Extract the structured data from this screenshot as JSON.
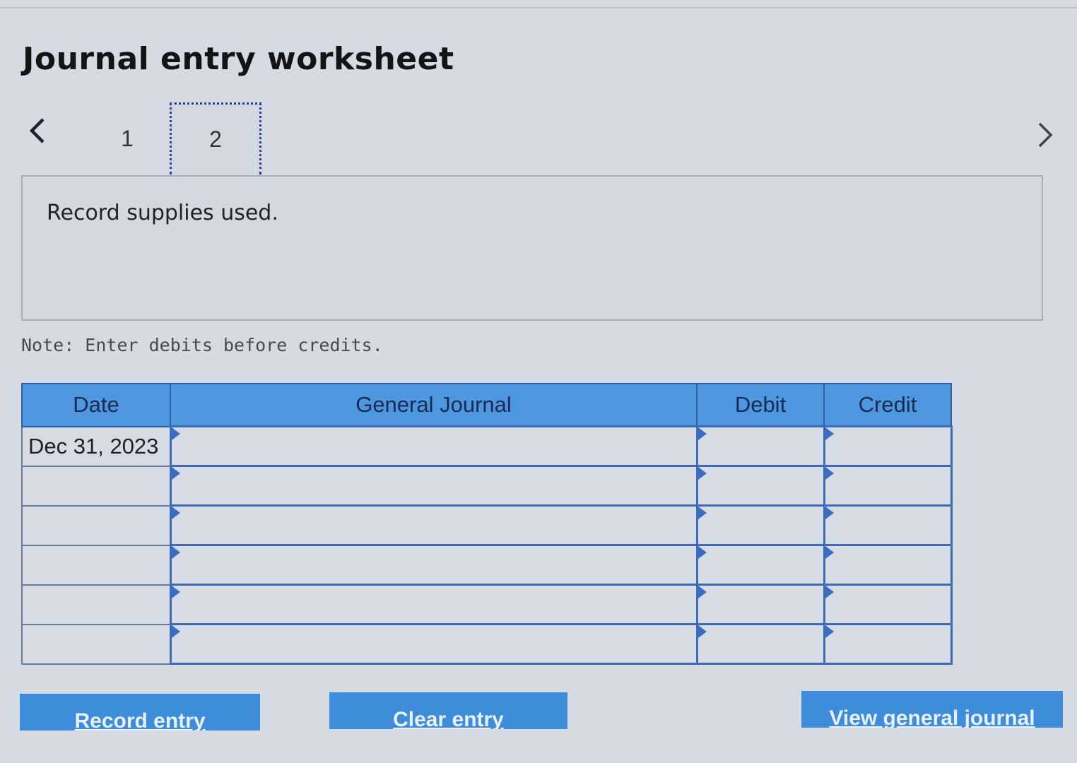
{
  "worksheet": {
    "title": "Journal entry worksheet",
    "steps": [
      "1",
      "2"
    ],
    "active_step": "2",
    "instruction": "Record supplies used.",
    "note": "Note: Enter debits before credits."
  },
  "table": {
    "headers": {
      "date": "Date",
      "general_journal": "General Journal",
      "debit": "Debit",
      "credit": "Credit"
    },
    "rows": [
      {
        "date": "Dec 31, 2023",
        "account": "",
        "debit": "",
        "credit": ""
      },
      {
        "date": "",
        "account": "",
        "debit": "",
        "credit": ""
      },
      {
        "date": "",
        "account": "",
        "debit": "",
        "credit": ""
      },
      {
        "date": "",
        "account": "",
        "debit": "",
        "credit": ""
      },
      {
        "date": "",
        "account": "",
        "debit": "",
        "credit": ""
      },
      {
        "date": "",
        "account": "",
        "debit": "",
        "credit": ""
      }
    ]
  },
  "buttons": {
    "record": "Record entry",
    "clear": "Clear entry",
    "view": "View general journal"
  },
  "icons": {
    "prev": "chevron-left-icon",
    "next": "chevron-right-icon"
  },
  "colors": {
    "header_blue": "#4d97de",
    "button_blue": "#3d8ddb",
    "cell_border": "#3e6ab8"
  }
}
